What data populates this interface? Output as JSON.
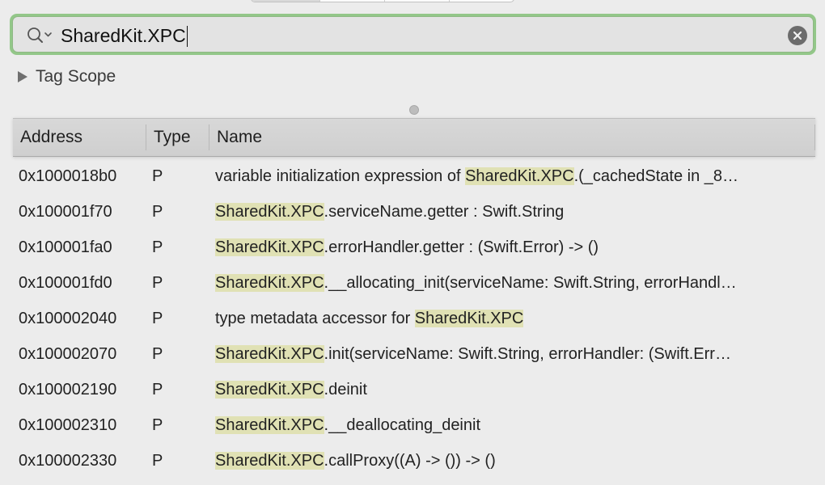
{
  "search": {
    "value": "SharedKit.XPC",
    "highlight_color": "#e0e1b4",
    "focus_ring_color": "#93c789"
  },
  "tag_scope": {
    "label": "Tag Scope"
  },
  "table": {
    "columns": {
      "address": "Address",
      "type": "Type",
      "name": "Name"
    },
    "rows": [
      {
        "address": "0x1000018b0",
        "type": "P",
        "pre": "variable initialization expression of ",
        "match": "SharedKit.XPC",
        "post": ".(_cachedState in _8…"
      },
      {
        "address": "0x100001f70",
        "type": "P",
        "pre": "",
        "match": "SharedKit.XPC",
        "post": ".serviceName.getter : Swift.String"
      },
      {
        "address": "0x100001fa0",
        "type": "P",
        "pre": "",
        "match": "SharedKit.XPC",
        "post": ".errorHandler.getter : (Swift.Error) -> ()"
      },
      {
        "address": "0x100001fd0",
        "type": "P",
        "pre": "",
        "match": "SharedKit.XPC",
        "post": ".__allocating_init(serviceName: Swift.String, errorHandl…"
      },
      {
        "address": "0x100002040",
        "type": "P",
        "pre": "type metadata accessor for ",
        "match": "SharedKit.XPC",
        "post": ""
      },
      {
        "address": "0x100002070",
        "type": "P",
        "pre": "",
        "match": "SharedKit.XPC",
        "post": ".init(serviceName: Swift.String, errorHandler: (Swift.Err…"
      },
      {
        "address": "0x100002190",
        "type": "P",
        "pre": "",
        "match": "SharedKit.XPC",
        "post": ".deinit"
      },
      {
        "address": "0x100002310",
        "type": "P",
        "pre": "",
        "match": "SharedKit.XPC",
        "post": ".__deallocating_deinit"
      },
      {
        "address": "0x100002330",
        "type": "P",
        "pre": "",
        "match": "SharedKit.XPC",
        "post": ".callProxy((A) -> ()) -> ()"
      }
    ]
  },
  "icons": {
    "search": "magnifier-with-dropdown",
    "clear": "x-circle",
    "disclosure": "triangle-right"
  }
}
